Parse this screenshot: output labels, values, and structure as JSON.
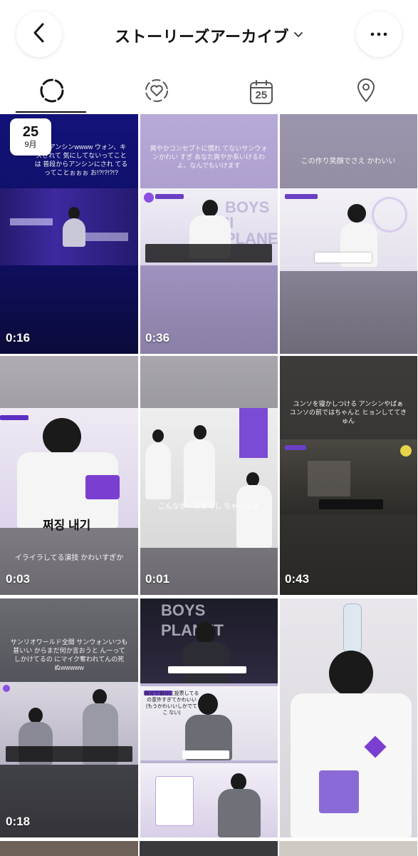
{
  "header": {
    "title": "ストーリーズアーカイブ",
    "back_icon": "chevron-left-icon",
    "more_icon": "more-horizontal-icon",
    "dropdown_icon": "chevron-down-icon"
  },
  "tabs": [
    {
      "name": "stories",
      "icon": "dashed-circle-icon",
      "active": true
    },
    {
      "name": "highlights",
      "icon": "heart-circle-icon",
      "active": false
    },
    {
      "name": "calendar",
      "icon": "calendar-icon",
      "label": "25",
      "active": false
    },
    {
      "name": "map",
      "icon": "location-pin-icon",
      "active": false
    }
  ],
  "date_badge": {
    "day": "25",
    "month": "9月"
  },
  "tiles": [
    {
      "duration": "0:16",
      "caption": "魔なアンシンwwww ウォン、キスされて 気にしてないってことは 普段からアンシンにされ てるってことぉぉぉ お!?!?!?!?"
    },
    {
      "duration": "0:36",
      "caption": "爽やかコンセプトに慣れ てないサンウォンかわい すぎ あなた爽やか系いけるわ よ。なんでもいけます"
    },
    {
      "duration": "",
      "caption": "この作り笑顔でさえ かわいい"
    },
    {
      "duration": "0:03",
      "caption": "イライラしてる演技 かわいすぎか",
      "korean": "쩌징 내기"
    },
    {
      "duration": "0:01",
      "caption": "こんなポーズまでし ちゃったよ"
    },
    {
      "duration": "0:43",
      "caption": "ユンソを寝かしつける アンシンやばぁ ユンソの前ではちゃんと ヒョンしててきゅん"
    },
    {
      "duration": "0:18",
      "caption": "サンリオワールド全開 サンウォンいつも甚いい からまだ何か言おうと んーってしかけてるの にマイク奪われてんの死 ぬwwwww"
    },
    {
      "duration": "",
      "caption": "自分で自分に投票してる の意外すぎてかわいい (もうかわいいしかでてこ ない)"
    },
    {
      "duration": "",
      "caption": ""
    }
  ]
}
